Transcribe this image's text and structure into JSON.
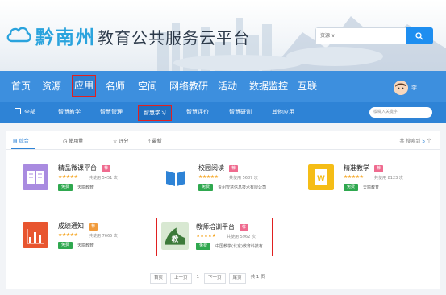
{
  "header": {
    "title_part1": "黔南州",
    "title_part2": "教育公共服务云平台",
    "search_select": "资源 ∨"
  },
  "mainnav": {
    "items": [
      {
        "label": "首页"
      },
      {
        "label": "资源"
      },
      {
        "label": "应用"
      },
      {
        "label": "名师"
      },
      {
        "label": "空间"
      },
      {
        "label": "网络教研"
      },
      {
        "label": "活动"
      },
      {
        "label": "数据监控"
      },
      {
        "label": "互联"
      }
    ],
    "active": "应用",
    "user_name": "李"
  },
  "subnav": {
    "items": [
      {
        "label": "全部"
      },
      {
        "label": "智慧教学"
      },
      {
        "label": "智慧管理"
      },
      {
        "label": "智慧学习"
      },
      {
        "label": "智慧评价"
      },
      {
        "label": "智慧研训"
      },
      {
        "label": "其他应用"
      }
    ],
    "active": "智慧学习",
    "search_placeholder": "模糊入关键字"
  },
  "filters": {
    "items": [
      {
        "label": "综合"
      },
      {
        "label": "使用量"
      },
      {
        "label": "评分"
      },
      {
        "label": "最新"
      }
    ],
    "total_prefix": "共",
    "total_mid": "搜索到",
    "total_count": "5",
    "total_suffix": "个"
  },
  "apps": [
    {
      "title": "精品微课平台",
      "tag": "荐",
      "stars": "★★★★★",
      "used": "共使用 5451 次",
      "free": "免费",
      "provider": "天喻教育",
      "color": "#9b78d8"
    },
    {
      "title": "校园阅读",
      "tag": "荐",
      "stars": "★★★★★",
      "used": "共使用 5687 次",
      "free": "免费",
      "provider": "贵州智慧信息技术有限公司",
      "color": "#2e83d6"
    },
    {
      "title": "精准教学",
      "tag": "荐",
      "stars": "★★★★★",
      "used": "共使用 8123 次",
      "free": "免费",
      "provider": "天喻教育",
      "color": "#f2b400"
    },
    {
      "title": "成绩通知",
      "tag": "荐",
      "stars": "★★★★★",
      "used": "共使用 7665 次",
      "free": "免费",
      "provider": "天喻教育",
      "color": "#e8552f"
    },
    {
      "title": "教师培训平台",
      "tag": "荐",
      "stars": "★★★★★",
      "used": "共使用 5962 次",
      "free": "免费",
      "provider": "中国教学(北京)教育科技有...",
      "color": "#3c7a3a"
    }
  ],
  "pager": {
    "first": "首页",
    "prev": "上一页",
    "current": "1",
    "next": "下一页",
    "last": "尾页",
    "total": "共 1 页"
  },
  "colors": {
    "nav": "#3d8fde",
    "subnav": "#2e83d6",
    "highlight": "#e02020",
    "free_badge": "#2fa84f"
  }
}
